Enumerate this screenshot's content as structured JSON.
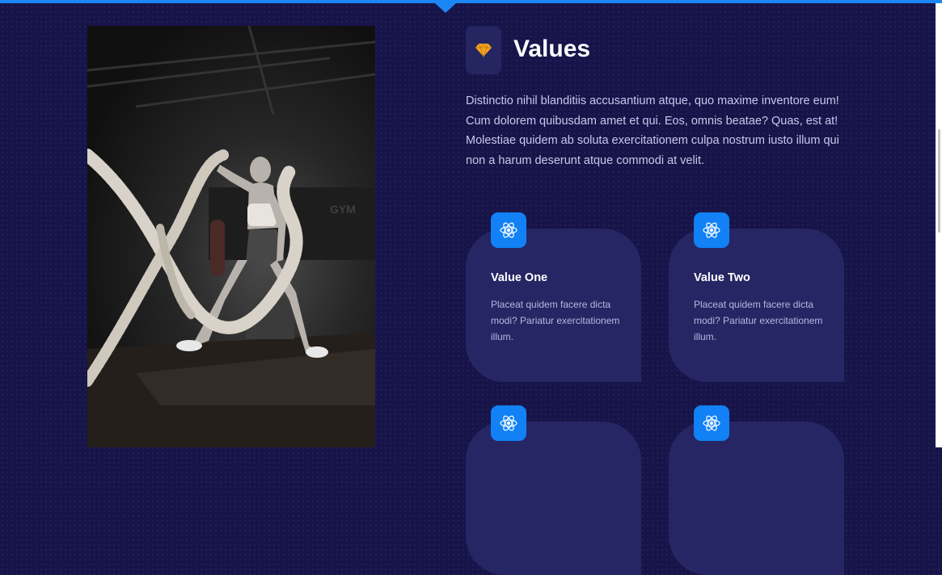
{
  "values": {
    "title": "Values",
    "icon": "gem-icon",
    "description": "Distinctio nihil blanditiis accusantium atque, quo maxime inventore eum! Cum dolorem quibusdam amet et qui. Eos, omnis beatae? Quas, est at! Molestiae quidem ab soluta exercitationem culpa nostrum iusto illum qui non a harum deserunt atque commodi at velit."
  },
  "photo": {
    "alt_text": "Woman training with battle ropes in a gym",
    "sign_text": "GYM"
  },
  "cards": [
    {
      "title": "Value One",
      "text": "Placeat quidem facere dicta modi? Pariatur exercitationem illum.",
      "icon": "atom-icon"
    },
    {
      "title": "Value Two",
      "text": "Placeat quidem facere dicta modi? Pariatur exercitationem illum.",
      "icon": "atom-icon"
    },
    {
      "title": "",
      "text": "",
      "icon": "atom-icon"
    },
    {
      "title": "",
      "text": "",
      "icon": "atom-icon"
    }
  ],
  "colors": {
    "background": "#17144a",
    "accent": "#1b86f4",
    "card": "#262664",
    "gem": "#f5a623"
  }
}
